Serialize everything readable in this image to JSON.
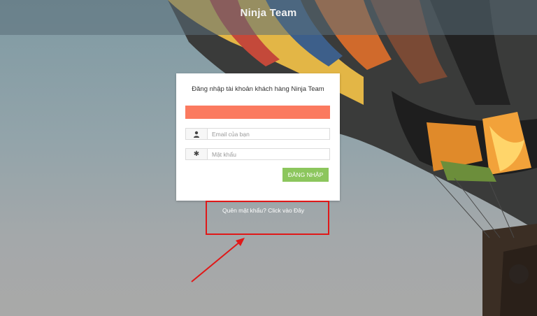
{
  "header": {
    "brand": "Ninja Team"
  },
  "login": {
    "title": "Đăng nhập tài khoản khách hàng Ninja Team",
    "email_placeholder": "Email của bạn",
    "password_placeholder": "Mật khẩu",
    "submit_label": "ĐĂNG NHẬP"
  },
  "footer_link": {
    "forgot_text": "Quên mật khẩu? Click vào Đây"
  },
  "icons": {
    "email": "user-icon",
    "password": "asterisk-icon"
  },
  "colors": {
    "alert": "#fb7a5f",
    "button": "#8cc65d",
    "annotation": "#e01818"
  }
}
